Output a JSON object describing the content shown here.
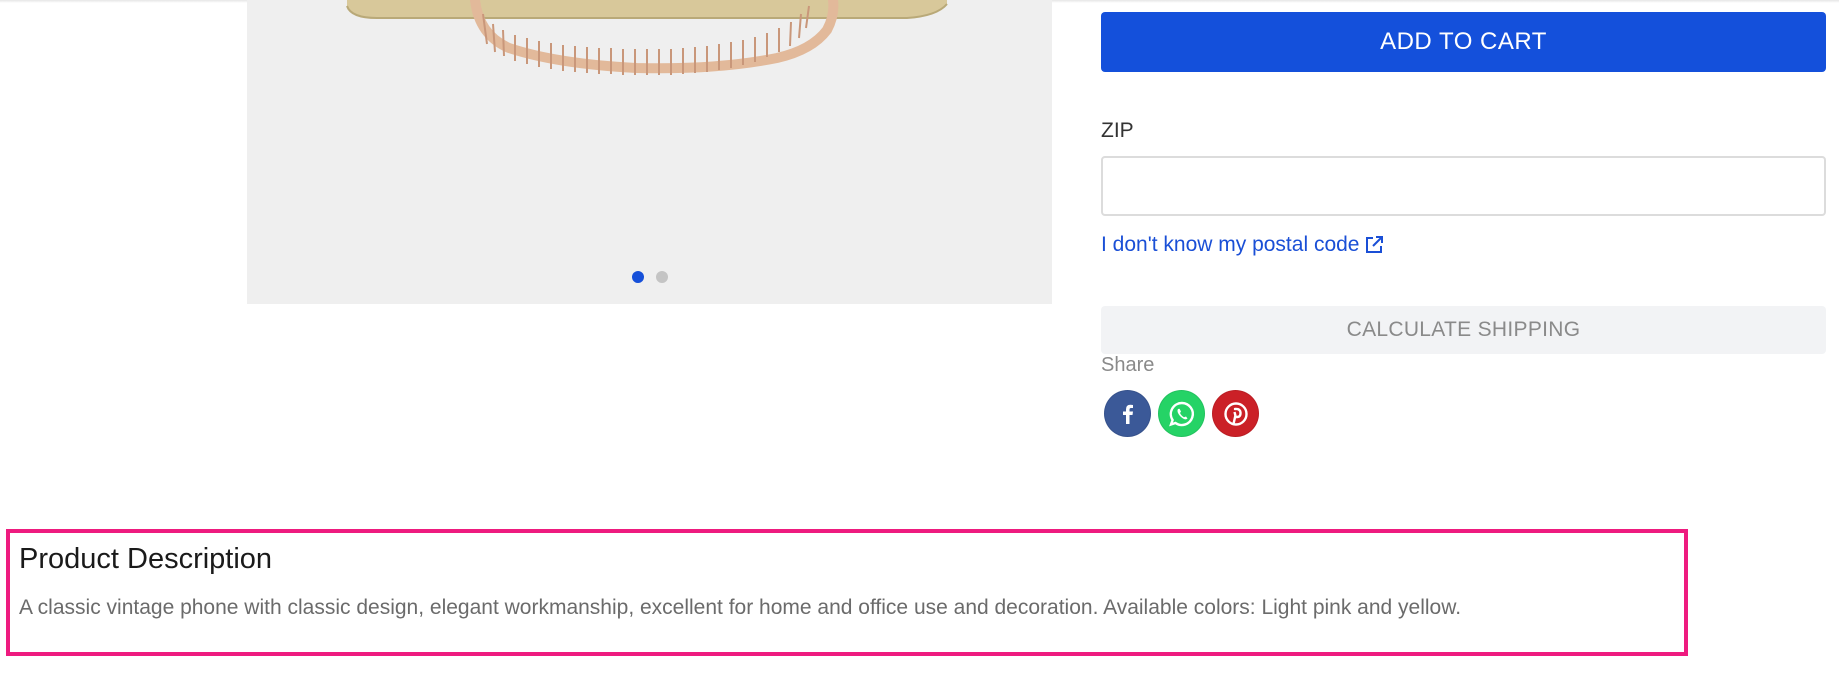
{
  "gallery": {
    "dots": [
      true,
      false
    ],
    "colors": {
      "background": "#efefef",
      "cord": "#e2b99a",
      "active_dot": "#1650d9"
    }
  },
  "cart": {
    "add_to_cart_label": "ADD TO CART",
    "zip_label": "ZIP",
    "zip_value": "",
    "postal_link_text": "I don't know my postal code",
    "calculate_label": "CALCULATE SHIPPING"
  },
  "share": {
    "label": "Share",
    "icons": [
      "facebook-icon",
      "whatsapp-icon",
      "pinterest-icon"
    ]
  },
  "description": {
    "title": "Product Description",
    "text": "A classic vintage phone with classic design, elegant workmanship, excellent for home and office use and decoration. Available colors: Light pink and yellow."
  },
  "colors": {
    "primary": "#1450db",
    "link": "#1a4fd6",
    "highlight": "#ee1b7f"
  }
}
